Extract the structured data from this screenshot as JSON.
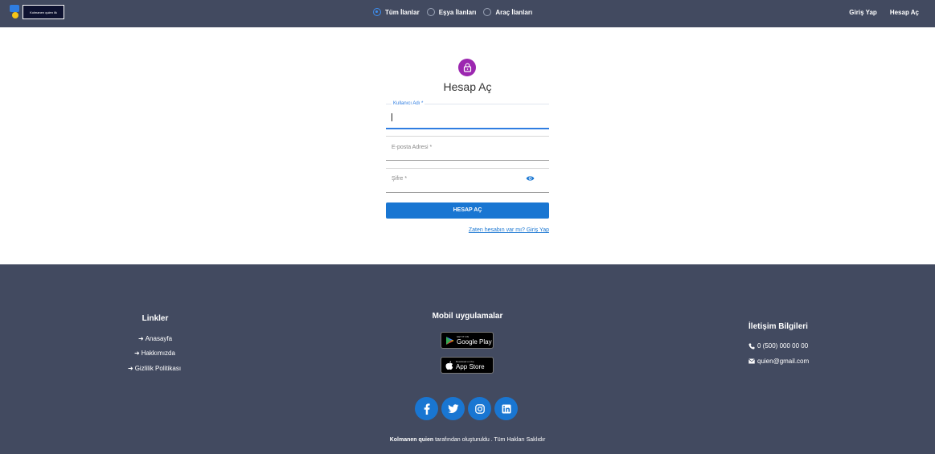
{
  "header": {
    "logo_text": "Kolmanen quien ilk",
    "filters": [
      {
        "label": "Tüm İlanlar",
        "checked": true
      },
      {
        "label": "Eşya İlanları",
        "checked": false
      },
      {
        "label": "Araç İlanları",
        "checked": false
      }
    ],
    "nav": {
      "login": "Giriş Yap",
      "register": "Hesap Aç"
    }
  },
  "form": {
    "title": "Hesap Aç",
    "username_label": "Kullanıcı Adı *",
    "email_label": "E-posta Adresi *",
    "password_label": "Şifre *",
    "submit_label": "HESAP AÇ",
    "login_link": "Zaten hesabın var mı? Giriş Yap"
  },
  "footer": {
    "links_title": "Linkler",
    "links": [
      "Anasayfa",
      "Hakkımızda",
      "Gizlilik Politikası"
    ],
    "mobile_title": "Mobil uygulamalar",
    "google_play_small": "GET IT ON",
    "google_play_big": "Google Play",
    "app_store_small": "Download on the",
    "app_store_big": "App Store",
    "contact_title": "İletişim Bilgileri",
    "phone": "0 (500) 000 00 00",
    "email": "quien@gmail.com",
    "copyright_brand": "Kolmanen quien",
    "copyright_rest": "tarafından oluşturuldu . Tüm Hakları Saklıdır"
  }
}
